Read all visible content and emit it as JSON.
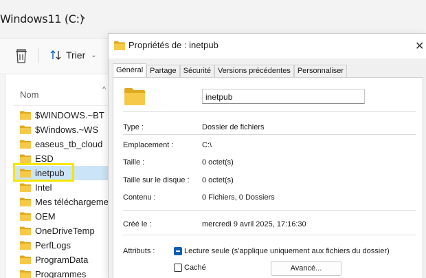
{
  "explorer": {
    "breadcrumb": "Windows11 (C:)",
    "toolbar": {
      "sort_label": "Trier"
    },
    "column_header": "Nom",
    "items": [
      {
        "label": "$WINDOWS.~BT"
      },
      {
        "label": "$Windows.~WS"
      },
      {
        "label": "easeus_tb_cloud"
      },
      {
        "label": "ESD"
      },
      {
        "label": "inetpub"
      },
      {
        "label": "Intel"
      },
      {
        "label": "Mes téléchargements"
      },
      {
        "label": "OEM"
      },
      {
        "label": "OneDriveTemp"
      },
      {
        "label": "PerfLogs"
      },
      {
        "label": "ProgramData"
      },
      {
        "label": "Programmes"
      }
    ],
    "selected_index": 4,
    "highlight_color": "#f5e600"
  },
  "dialog": {
    "title": "Propriétés de : inetpub",
    "tabs": [
      {
        "label": "Général"
      },
      {
        "label": "Partage"
      },
      {
        "label": "Sécurité"
      },
      {
        "label": "Versions précédentes"
      },
      {
        "label": "Personnaliser"
      }
    ],
    "active_tab": "Général",
    "name": "inetpub",
    "props": {
      "type_label": "Type :",
      "type_value": "Dossier de fichiers",
      "location_label": "Emplacement :",
      "location_value": "C:\\",
      "size_label": "Taille :",
      "size_value": "0 octet(s)",
      "disk_size_label": "Taille sur le disque :",
      "disk_size_value": "0 octet(s)",
      "contents_label": "Contenu :",
      "contents_value": "0 Fichiers, 0 Dossiers",
      "created_label": "Créé le :",
      "created_value": "mercredi 9 avril 2025, 17:16:30"
    },
    "attributes": {
      "label": "Attributs :",
      "readonly_label": "Lecture seule (s'applique uniquement aux fichiers du dossier)",
      "hidden_label": "Caché",
      "advanced_button": "Avancé..."
    }
  },
  "colors": {
    "folder": "#f7c948",
    "folder_dark": "#e0a91f",
    "accent": "#0a5fb4"
  },
  "icons": [
    "trash-icon",
    "sort-icon",
    "chevron-right-icon",
    "folder-icon",
    "close-icon"
  ]
}
